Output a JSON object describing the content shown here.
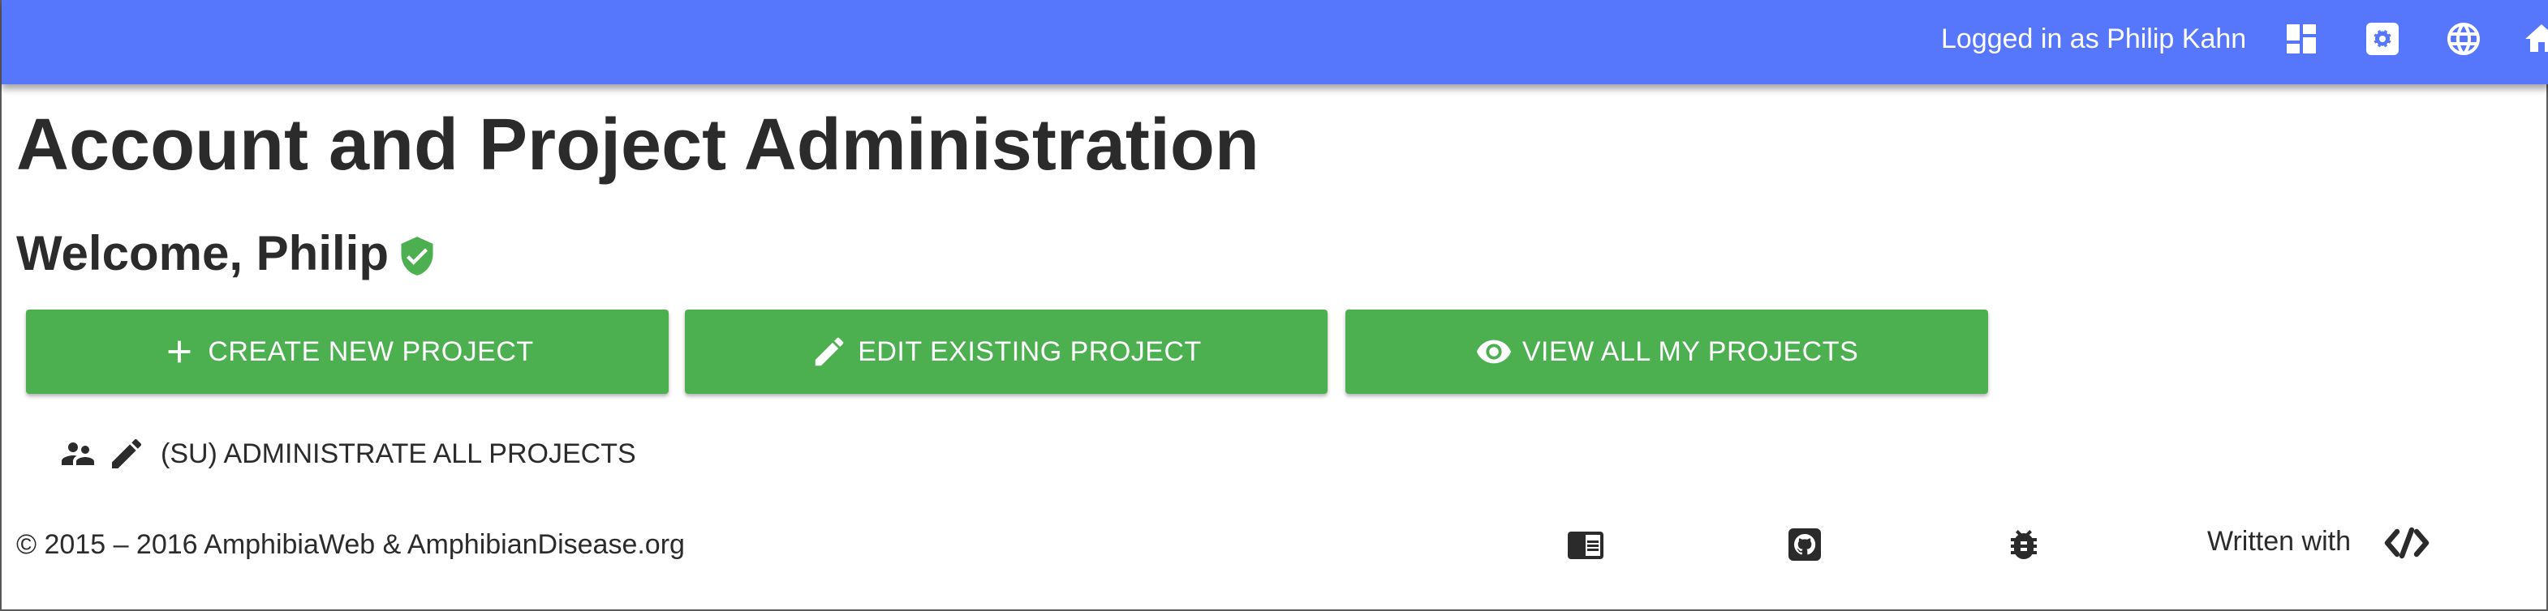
{
  "header": {
    "login_text": "Logged in as Philip Kahn",
    "icons": [
      "dashboard-icon",
      "settings-icon",
      "globe-icon",
      "home-icon"
    ],
    "background_color": "#5677fc"
  },
  "main": {
    "title": "Account and Project Administration",
    "welcome": "Welcome, Philip",
    "verified_icon": "verified-user-icon",
    "buttons": [
      {
        "label": "CREATE NEW PROJECT",
        "icon": "add-icon"
      },
      {
        "label": "EDIT EXISTING PROJECT",
        "icon": "edit-icon"
      },
      {
        "label": "VIEW ALL MY PROJECTS",
        "icon": "visibility-icon"
      }
    ],
    "button_color": "#4caf50",
    "admin_link": {
      "label": "(SU) ADMINISTRATE ALL PROJECTS",
      "icons": [
        "supervisor-icon",
        "pencil-icon"
      ]
    }
  },
  "footer": {
    "copyright": "© 2015 – 2016 AmphibiaWeb & AmphibianDisease.org",
    "icons": [
      "chrome-reader-icon",
      "github-icon",
      "bug-report-icon"
    ],
    "written_with": "Written with"
  }
}
